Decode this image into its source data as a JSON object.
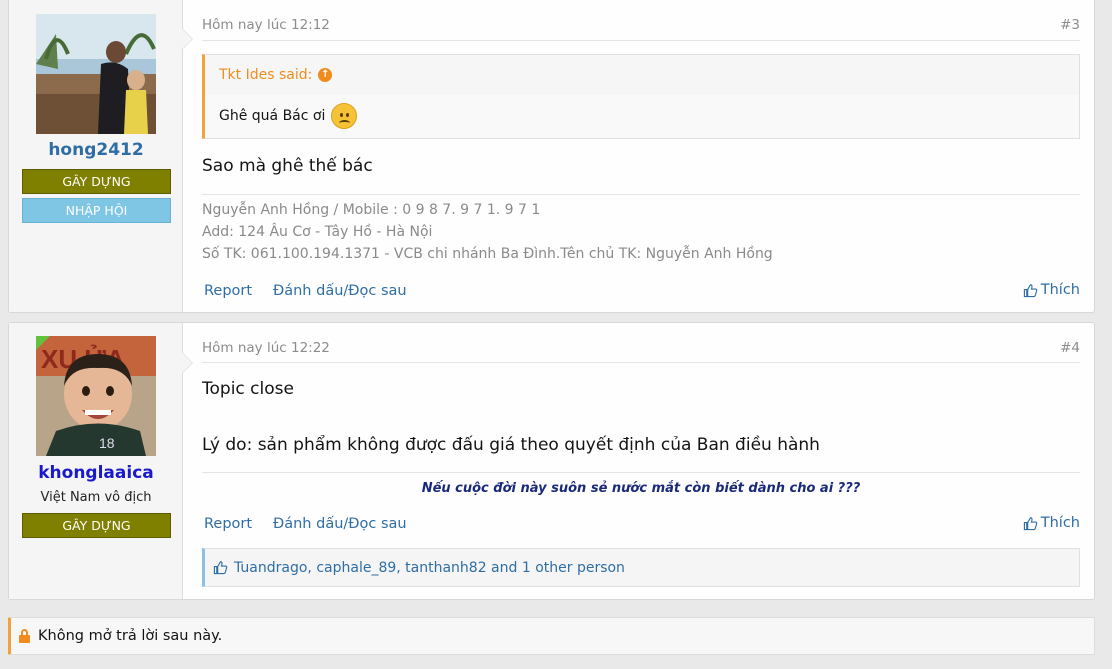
{
  "posts": [
    {
      "username": "hong2412",
      "badges": [
        "GÂY DỰNG",
        "NHẬP HỘI"
      ],
      "date": "Hôm nay lúc 12:12",
      "number": "#3",
      "quote_author": "Tkt Ides said:",
      "quote_text": "Ghê quá Bác ơi",
      "quote_emoji": "sad-face-icon",
      "message": "Sao mà ghê thế bác",
      "signature": [
        "Nguyễn Anh Hồng / Mobile : 0 9 8 7. 9 7 1. 9 7 1",
        "Add: 124 Âu Cơ - Tây Hồ - Hà Nội",
        "Số TK: 061.100.194.1371 - VCB chi nhánh Ba Đình.Tên chủ TK: Nguyễn Anh Hồng"
      ],
      "actions": [
        "Report",
        "Đánh dấu/Đọc sau"
      ],
      "like_label": "Thích"
    },
    {
      "username": "khonglaaica",
      "user_title": "Việt Nam vô địch",
      "badges": [
        "GÂY DỰNG"
      ],
      "date": "Hôm nay lúc 12:22",
      "number": "#4",
      "message_lines": [
        "Topic close",
        "Lý do: sản phẩm không được đấu giá theo quyết định của Ban điều hành"
      ],
      "signature": "Nếu cuộc đời này suôn sẻ nước mắt còn biết dành cho ai ???",
      "actions": [
        "Report",
        "Đánh dấu/Đọc sau"
      ],
      "like_label": "Thích",
      "likes_text": "Tuandrago, caphale_89, tanthanh82 and 1 other person"
    }
  ],
  "locked_notice": "Không mở trả lời sau này.",
  "colors": {
    "badge_build": "#808000",
    "badge_join": "#7ec6e4",
    "link": "#2f6ea5",
    "quote_accent": "#f3a23a",
    "username_post3": "#2f6ea5",
    "username_post4": "#1a1acc"
  }
}
